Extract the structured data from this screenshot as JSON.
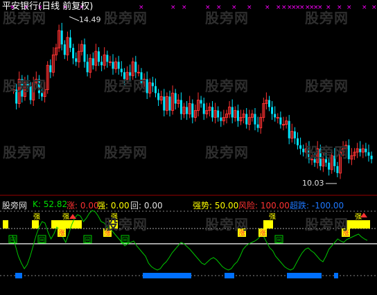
{
  "title": "平安银行(日线 前复权)",
  "watermark_text": "股旁网",
  "price_panel": {
    "high_label": "14.49",
    "low_label": "10.03"
  },
  "indicator_panel": {
    "name": "股旁网",
    "k_label": "K:",
    "k_value": "52.82",
    "zhang_label": "涨:",
    "zhang_value": "0.00",
    "qiang_label": "强:",
    "qiang_value": "0.00",
    "hui_label": "回:",
    "hui_value": "0.00",
    "qiangshi_label": "强势:",
    "qiangshi_value": "50.00",
    "fengxian_label": "风险:",
    "fengxian_value": "100.00",
    "chaodie_label": "超跌:",
    "chaodie_value": "-100.00"
  },
  "marker_labels": {
    "zhang": "涨",
    "qiang": "强",
    "hui": "回"
  },
  "colors": {
    "up": "#ff3232",
    "down": "#00e5ff",
    "k_line": "#00c800",
    "yellow": "#ffff00",
    "blue": "#0070ff",
    "magenta": "#ff00ff",
    "hl_white": "#e0e0e0"
  },
  "chart_data": [
    {
      "type": "candlestick",
      "title": "平安银行(日线 前复权)",
      "annotations": [
        "14.49",
        "10.03"
      ],
      "close_series_approx": [
        12.6,
        12.2,
        12.9,
        12.4,
        12.8,
        12.7,
        12.3,
        12.8,
        12.9,
        12.5,
        12.4,
        12.6,
        13.3,
        13.1,
        13.6,
        13.8,
        14.3,
        13.9,
        13.6,
        14.1,
        13.8,
        13.5,
        13.4,
        13.7,
        13.9,
        13.4,
        13.1,
        13.5,
        13.3,
        13.7,
        13.4,
        13.3,
        13.6,
        13.4,
        13.4,
        13.2,
        13.4,
        13.2,
        13.1,
        12.9,
        13.1,
        13.0,
        13.4,
        13.1,
        13.1,
        12.8,
        12.9,
        12.5,
        12.8,
        12.7,
        12.5,
        12.3,
        12.4,
        12.0,
        12.4,
        12.0,
        12.5,
        12.2,
        12.3,
        11.9,
        12.1,
        11.9,
        12.2,
        11.8,
        12.0,
        12.3,
        12.2,
        11.9,
        12.0,
        12.1,
        11.8,
        12.0,
        11.8,
        11.7,
        11.8,
        11.9,
        12.1,
        11.8,
        12.0,
        11.7,
        11.8,
        11.9,
        11.6,
        11.8,
        11.9,
        11.6,
        11.5,
        11.8,
        12.2,
        12.3,
        12.1,
        11.9,
        11.8,
        11.8,
        11.6,
        11.6,
        11.7,
        11.2,
        11.4,
        11.2,
        11.0,
        10.9,
        10.8,
        10.9,
        10.6,
        10.6,
        10.5,
        10.9,
        10.4,
        10.6,
        10.5,
        10.3,
        10.7,
        10.4,
        10.2,
        10.8,
        10.9,
        11.0,
        10.6,
        10.7,
        10.8,
        10.9,
        10.8,
        10.9,
        10.8,
        10.7,
        10.6
      ]
    },
    {
      "type": "line",
      "series": [
        {
          "name": "K",
          "values": [
            60,
            45,
            30,
            20,
            12,
            18,
            30,
            45,
            60,
            72,
            80,
            78,
            65,
            55,
            62,
            72,
            68,
            58,
            50,
            62,
            75,
            85,
            90,
            88,
            80,
            85,
            92,
            96,
            94,
            88,
            80,
            78,
            72,
            70,
            65,
            60,
            55,
            50,
            45,
            48,
            50,
            52,
            45,
            40,
            35,
            30,
            20,
            15,
            12,
            10,
            12,
            18,
            22,
            28,
            35,
            40,
            45,
            50,
            48,
            44,
            40,
            35,
            30,
            25,
            20,
            18,
            22,
            26,
            28,
            25,
            20,
            15,
            12,
            10,
            12,
            18,
            22,
            30,
            40,
            45,
            48,
            50,
            52,
            55,
            60,
            58,
            50,
            42,
            38,
            30,
            25,
            20,
            15,
            12,
            10,
            12,
            20,
            28,
            35,
            40,
            42,
            38,
            35,
            30,
            25,
            22,
            30,
            40,
            45,
            50,
            55,
            52,
            50,
            54,
            56,
            58,
            60,
            62,
            58,
            55,
            52.82
          ]
        }
      ]
    }
  ]
}
